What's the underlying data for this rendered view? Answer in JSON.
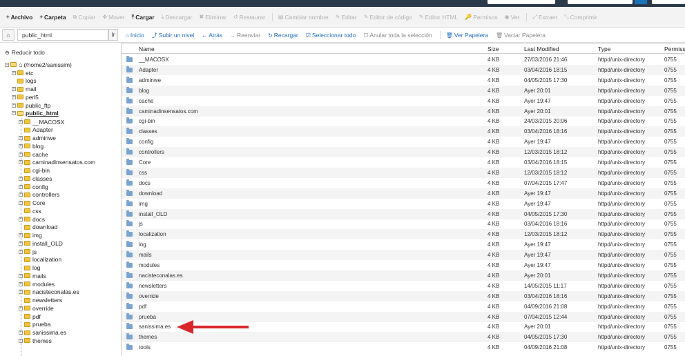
{
  "toolbar": {
    "items": [
      {
        "label": "Archivo",
        "icon": "+",
        "enabled": true
      },
      {
        "label": "Carpeta",
        "icon": "+",
        "enabled": true
      },
      {
        "label": "Copiar",
        "icon": "⧉",
        "enabled": false
      },
      {
        "label": "Mover",
        "icon": "✥",
        "enabled": false
      },
      {
        "label": "Cargar",
        "icon": "⤒",
        "enabled": true
      },
      {
        "label": "Descargar",
        "icon": "⤓",
        "enabled": false
      },
      {
        "label": "Eliminar",
        "icon": "✖",
        "enabled": false
      },
      {
        "label": "Restaurar",
        "icon": "↺",
        "enabled": false
      },
      {
        "label": "Cambiar nombre",
        "icon": "▤",
        "enabled": false
      },
      {
        "label": "Editar",
        "icon": "✎",
        "enabled": false
      },
      {
        "label": "Editor de código",
        "icon": "✎",
        "enabled": false
      },
      {
        "label": "Editor HTML",
        "icon": "✎",
        "enabled": false
      },
      {
        "label": "Permisos",
        "icon": "🔑",
        "enabled": false
      },
      {
        "label": "Ver",
        "icon": "◉",
        "enabled": false
      },
      {
        "label": "Extraer",
        "icon": "⤢",
        "enabled": false
      },
      {
        "label": "Comprimir",
        "icon": "⤡",
        "enabled": false
      }
    ]
  },
  "pathbar": {
    "path_value": "public_html",
    "go_label": "Ir"
  },
  "nav": {
    "items": [
      {
        "label": "Inicio",
        "icon": "⌂",
        "style": "blue"
      },
      {
        "label": "Subir un nivel",
        "icon": "⤴",
        "style": "blue"
      },
      {
        "label": "Atrás",
        "icon": "←",
        "style": "blue"
      },
      {
        "label": "Reenviar",
        "icon": "→",
        "style": "grey"
      },
      {
        "label": "Recargar",
        "icon": "↻",
        "style": "blue"
      },
      {
        "label": "Seleccionar todo",
        "icon": "☑",
        "style": "blue"
      },
      {
        "label": "Anular toda la selección",
        "icon": "☐",
        "style": "grey"
      },
      {
        "label": "Ver Papelera",
        "icon": "🗑",
        "style": "blue"
      },
      {
        "label": "Vaciar Papelera",
        "icon": "🗑",
        "style": "grey"
      }
    ]
  },
  "tree": {
    "collapse_label": "Reducir todo",
    "root_label": "(/home2/sanissim)",
    "top_nodes": [
      {
        "label": "etc",
        "expander": "+"
      },
      {
        "label": "logs",
        "expander": ""
      },
      {
        "label": "mail",
        "expander": "+"
      },
      {
        "label": "perl5",
        "expander": "+"
      },
      {
        "label": "public_ftp",
        "expander": "+"
      },
      {
        "label": "public_html",
        "expander": "−",
        "bold": true
      }
    ],
    "children": [
      {
        "label": "__MACOSX",
        "expander": "+"
      },
      {
        "label": "Adapter",
        "expander": ""
      },
      {
        "label": "adminwe",
        "expander": "+"
      },
      {
        "label": "blog",
        "expander": "+"
      },
      {
        "label": "cache",
        "expander": "+"
      },
      {
        "label": "caminadinsensatos.com",
        "expander": "+"
      },
      {
        "label": "cgi-bin",
        "expander": ""
      },
      {
        "label": "classes",
        "expander": "+"
      },
      {
        "label": "config",
        "expander": "+"
      },
      {
        "label": "controllers",
        "expander": "+"
      },
      {
        "label": "Core",
        "expander": "+"
      },
      {
        "label": "css",
        "expander": ""
      },
      {
        "label": "docs",
        "expander": "+"
      },
      {
        "label": "download",
        "expander": ""
      },
      {
        "label": "img",
        "expander": "+"
      },
      {
        "label": "install_OLD",
        "expander": "+"
      },
      {
        "label": "js",
        "expander": "+"
      },
      {
        "label": "localization",
        "expander": ""
      },
      {
        "label": "log",
        "expander": ""
      },
      {
        "label": "mails",
        "expander": "+"
      },
      {
        "label": "modules",
        "expander": "+"
      },
      {
        "label": "nacisteconalas.es",
        "expander": "+"
      },
      {
        "label": "newsletters",
        "expander": ""
      },
      {
        "label": "override",
        "expander": "+"
      },
      {
        "label": "pdf",
        "expander": ""
      },
      {
        "label": "prueba",
        "expander": ""
      },
      {
        "label": "sanissima.es",
        "expander": "+"
      },
      {
        "label": "themes",
        "expander": "+"
      }
    ]
  },
  "table": {
    "headers": {
      "name": "Name",
      "size": "Size",
      "modified": "Last Modified",
      "type": "Type",
      "perms": "Permissions"
    },
    "rows": [
      {
        "name": "__MACOSX",
        "size": "4 KB",
        "modified": "27/03/2016 21:46",
        "type": "httpd/unix-directory",
        "perms": "0755"
      },
      {
        "name": "Adapter",
        "size": "4 KB",
        "modified": "03/04/2016 18:15",
        "type": "httpd/unix-directory",
        "perms": "0755"
      },
      {
        "name": "adminwe",
        "size": "4 KB",
        "modified": "04/05/2015 17:30",
        "type": "httpd/unix-directory",
        "perms": "0755"
      },
      {
        "name": "blog",
        "size": "4 KB",
        "modified": "Ayer 20:01",
        "type": "httpd/unix-directory",
        "perms": "0755"
      },
      {
        "name": "cache",
        "size": "4 KB",
        "modified": "Ayer 19:47",
        "type": "httpd/unix-directory",
        "perms": "0755"
      },
      {
        "name": "caminadinsensatos.com",
        "size": "4 KB",
        "modified": "Ayer 20:01",
        "type": "httpd/unix-directory",
        "perms": "0755"
      },
      {
        "name": "cgi-bin",
        "size": "4 KB",
        "modified": "24/03/2015 20:06",
        "type": "httpd/unix-directory",
        "perms": "0755"
      },
      {
        "name": "classes",
        "size": "4 KB",
        "modified": "03/04/2016 18:16",
        "type": "httpd/unix-directory",
        "perms": "0755"
      },
      {
        "name": "config",
        "size": "4 KB",
        "modified": "Ayer 19:47",
        "type": "httpd/unix-directory",
        "perms": "0755"
      },
      {
        "name": "controllers",
        "size": "4 KB",
        "modified": "12/03/2015 18:12",
        "type": "httpd/unix-directory",
        "perms": "0755"
      },
      {
        "name": "Core",
        "size": "4 KB",
        "modified": "03/04/2016 18:15",
        "type": "httpd/unix-directory",
        "perms": "0755"
      },
      {
        "name": "css",
        "size": "4 KB",
        "modified": "12/03/2015 18:12",
        "type": "httpd/unix-directory",
        "perms": "0755"
      },
      {
        "name": "docs",
        "size": "4 KB",
        "modified": "07/04/2015 17:47",
        "type": "httpd/unix-directory",
        "perms": "0755"
      },
      {
        "name": "download",
        "size": "4 KB",
        "modified": "Ayer 19:47",
        "type": "httpd/unix-directory",
        "perms": "0755"
      },
      {
        "name": "img",
        "size": "4 KB",
        "modified": "Ayer 19:47",
        "type": "httpd/unix-directory",
        "perms": "0755"
      },
      {
        "name": "install_OLD",
        "size": "4 KB",
        "modified": "04/05/2015 17:30",
        "type": "httpd/unix-directory",
        "perms": "0755"
      },
      {
        "name": "js",
        "size": "4 KB",
        "modified": "03/04/2016 18:16",
        "type": "httpd/unix-directory",
        "perms": "0755"
      },
      {
        "name": "localization",
        "size": "4 KB",
        "modified": "12/03/2015 18:12",
        "type": "httpd/unix-directory",
        "perms": "0755"
      },
      {
        "name": "log",
        "size": "4 KB",
        "modified": "Ayer 19:47",
        "type": "httpd/unix-directory",
        "perms": "0755"
      },
      {
        "name": "mails",
        "size": "4 KB",
        "modified": "Ayer 19:47",
        "type": "httpd/unix-directory",
        "perms": "0755"
      },
      {
        "name": "modules",
        "size": "4 KB",
        "modified": "Ayer 19:47",
        "type": "httpd/unix-directory",
        "perms": "0755"
      },
      {
        "name": "nacisteconalas.es",
        "size": "4 KB",
        "modified": "Ayer 20:01",
        "type": "httpd/unix-directory",
        "perms": "0755"
      },
      {
        "name": "newsletters",
        "size": "4 KB",
        "modified": "14/05/2015 11:17",
        "type": "httpd/unix-directory",
        "perms": "0755"
      },
      {
        "name": "override",
        "size": "4 KB",
        "modified": "03/04/2016 18:16",
        "type": "httpd/unix-directory",
        "perms": "0755"
      },
      {
        "name": "pdf",
        "size": "4 KB",
        "modified": "04/09/2016 21:08",
        "type": "httpd/unix-directory",
        "perms": "0755"
      },
      {
        "name": "prueba",
        "size": "4 KB",
        "modified": "07/04/2015 12:44",
        "type": "httpd/unix-directory",
        "perms": "0755"
      },
      {
        "name": "sanissima.es",
        "size": "4 KB",
        "modified": "Ayer 20:01",
        "type": "httpd/unix-directory",
        "perms": "0755"
      },
      {
        "name": "themes",
        "size": "4 KB",
        "modified": "04/05/2015 17:30",
        "type": "httpd/unix-directory",
        "perms": "0755"
      },
      {
        "name": "tools",
        "size": "4 KB",
        "modified": "04/09/2016 21:08",
        "type": "httpd/unix-directory",
        "perms": "0755"
      }
    ]
  },
  "colors": {
    "topbar": "#2b3a4a",
    "link_blue": "#1f6cbf",
    "arrow_red": "#d9262c",
    "folder_yellow": "#f1c542",
    "folder_blue": "#7aa4d0"
  }
}
